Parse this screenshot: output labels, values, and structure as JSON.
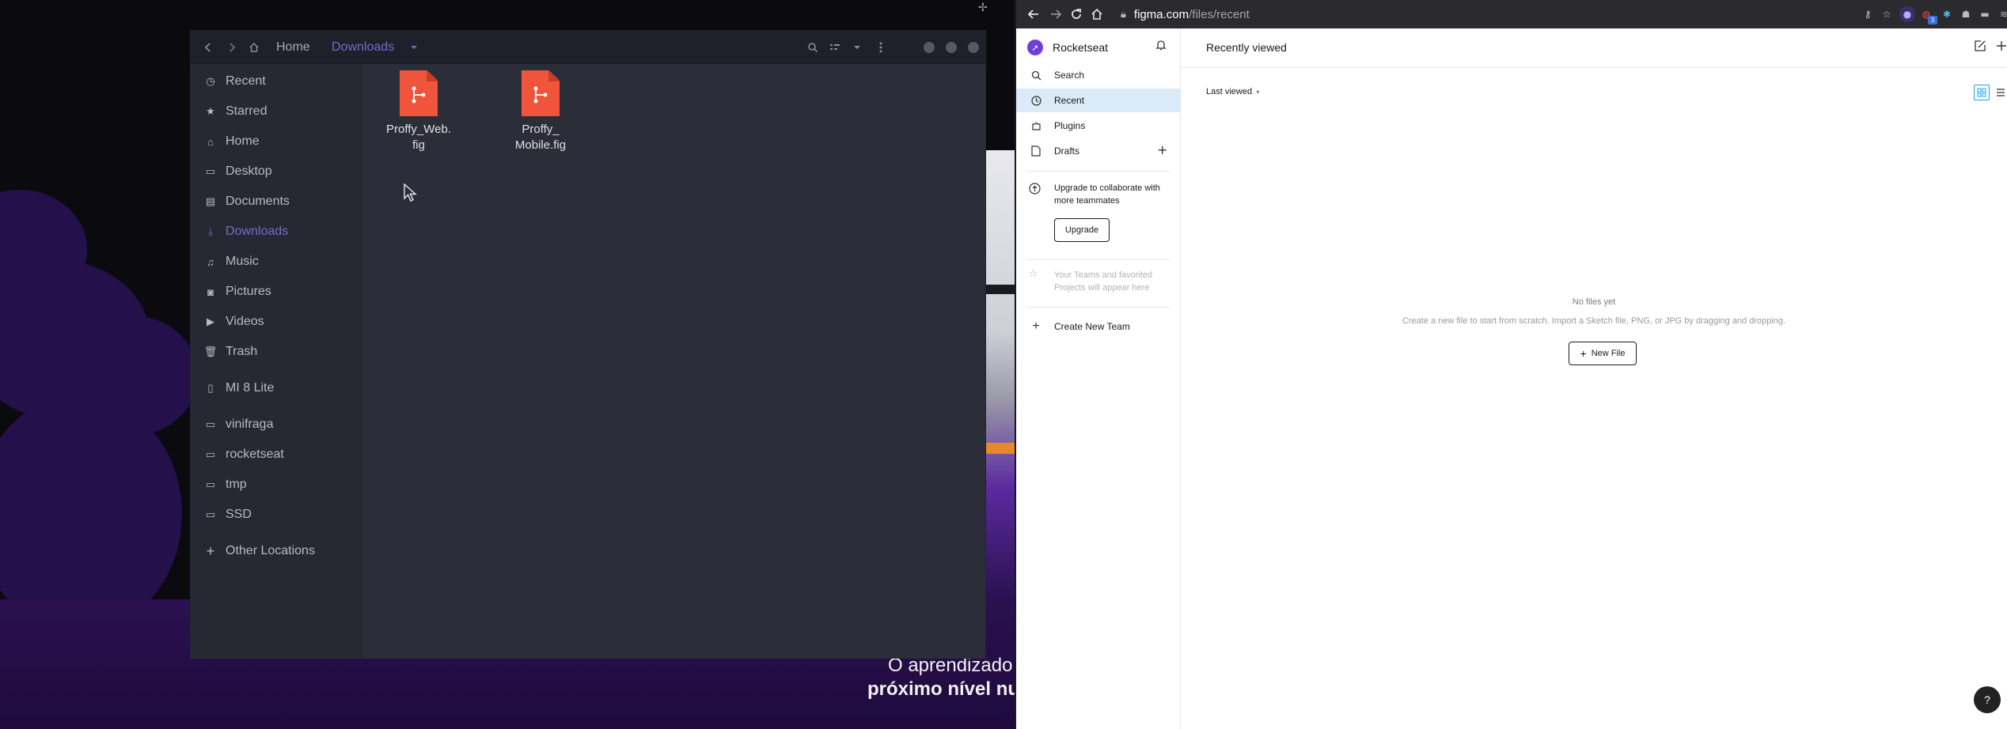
{
  "desktop": {
    "caption_line1": "O aprendizado",
    "caption_line2": "próximo nível nu"
  },
  "file_manager": {
    "breadcrumb": {
      "home": "Home",
      "current": "Downloads"
    },
    "icons": [
      "back-icon",
      "forward-icon",
      "home-icon",
      "search-icon",
      "view-list-icon",
      "sort-dropdown-icon",
      "menu-icon"
    ],
    "sidebar": [
      {
        "label": "Recent",
        "icon": "clock-icon"
      },
      {
        "label": "Starred",
        "icon": "star-icon"
      },
      {
        "label": "Home",
        "icon": "home-icon"
      },
      {
        "label": "Desktop",
        "icon": "desktop-icon"
      },
      {
        "label": "Documents",
        "icon": "document-icon"
      },
      {
        "label": "Downloads",
        "icon": "download-icon",
        "active": true
      },
      {
        "label": "Music",
        "icon": "music-icon"
      },
      {
        "label": "Pictures",
        "icon": "camera-icon"
      },
      {
        "label": "Videos",
        "icon": "video-icon"
      },
      {
        "label": "Trash",
        "icon": "trash-icon"
      },
      {
        "label": "MI 8 Lite",
        "icon": "phone-icon"
      },
      {
        "label": "vinifraga",
        "icon": "folder-icon"
      },
      {
        "label": "rocketseat",
        "icon": "folder-icon"
      },
      {
        "label": "tmp",
        "icon": "folder-icon"
      },
      {
        "label": "SSD",
        "icon": "folder-icon"
      },
      {
        "label": "Other Locations",
        "icon": "plus-icon"
      }
    ],
    "files": [
      {
        "name": "Proffy_Web.\nfig"
      },
      {
        "name": "Proffy_\nMobile.fig"
      }
    ]
  },
  "browser": {
    "url_host": "figma.com",
    "url_path": "/files/recent",
    "extension_badge": "3"
  },
  "figma": {
    "team_name": "Rocketseat",
    "nav": [
      {
        "label": "Search",
        "icon": "search-icon"
      },
      {
        "label": "Recent",
        "icon": "clock-icon",
        "active": true
      },
      {
        "label": "Plugins",
        "icon": "plugin-icon"
      },
      {
        "label": "Drafts",
        "icon": "file-icon"
      }
    ],
    "upgrade_text": "Upgrade to collaborate with more teammates",
    "upgrade_button": "Upgrade",
    "teams_hint": "Your Teams and favorited Projects will appear here",
    "create_team": "Create New Team",
    "page_title": "Recently viewed",
    "sort_label": "Last viewed",
    "empty_title": "No files yet",
    "empty_sub": "Create a new file to start from scratch. Import a Sketch file, PNG, or JPG by dragging and dropping.",
    "new_file": "New File",
    "help": "?"
  },
  "colors": {
    "accent_purple": "#7b67c9",
    "figma_file_icon": "#f0543a",
    "figma_selected_nav": "#daebf7",
    "figma_blue": "#18a0fb"
  }
}
